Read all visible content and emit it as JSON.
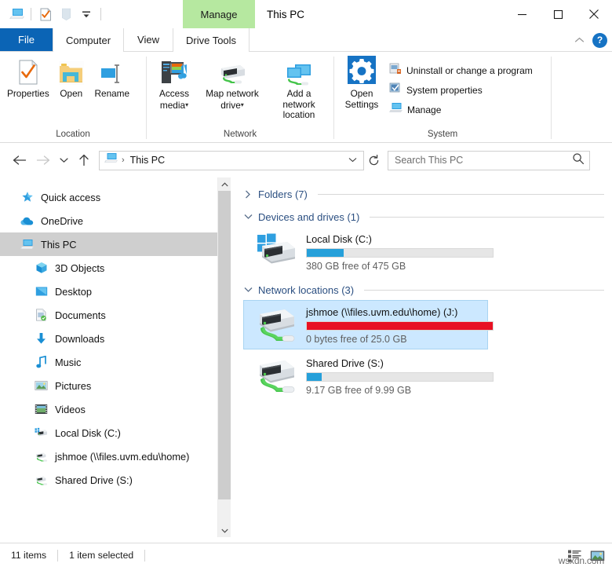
{
  "window": {
    "title": "This PC",
    "quick_access_toolbar": [
      {
        "name": "this-pc-icon",
        "label": "This PC"
      },
      {
        "name": "properties-icon",
        "label": "Properties"
      },
      {
        "name": "new-folder-icon",
        "label": "New folder"
      },
      {
        "name": "customize-qat-icon",
        "label": "Customize Quick Access Toolbar"
      }
    ],
    "controls": {
      "minimize": "Minimize",
      "maximize": "Maximize",
      "close": "Close"
    }
  },
  "contextual_tab": {
    "header": "Manage",
    "child_tab": "Drive Tools",
    "color": "#b6e8a0"
  },
  "tabs": [
    {
      "label": "File",
      "name": "tab-file",
      "state": "file"
    },
    {
      "label": "Computer",
      "name": "tab-computer",
      "state": "active"
    },
    {
      "label": "View",
      "name": "tab-view",
      "state": "normal"
    },
    {
      "label": "Drive Tools",
      "name": "tab-drive-tools",
      "state": "contextual"
    }
  ],
  "tabstrip_right": {
    "collapse_ribbon": "Minimize the Ribbon",
    "help": "?"
  },
  "ribbon": {
    "groups": [
      {
        "title": "Location",
        "name": "ribbon-group-location",
        "buttons": [
          {
            "label": "Properties",
            "name": "properties-button",
            "icon": "properties-icon",
            "has_caret": false
          },
          {
            "label": "Open",
            "name": "open-button",
            "icon": "open-folder-icon",
            "has_caret": false
          },
          {
            "label": "Rename",
            "name": "rename-button",
            "icon": "rename-icon",
            "has_caret": false
          }
        ]
      },
      {
        "title": "Network",
        "name": "ribbon-group-network",
        "buttons": [
          {
            "label": "Access\nmedia",
            "name": "access-media-button",
            "icon": "access-media-icon",
            "has_caret": true
          },
          {
            "label": "Map network\ndrive",
            "name": "map-network-drive-button",
            "icon": "network-drive-icon",
            "has_caret": true
          },
          {
            "label": "Add a network\nlocation",
            "name": "add-network-location-button",
            "icon": "add-network-location-icon",
            "has_caret": false
          }
        ]
      },
      {
        "title": "System",
        "name": "ribbon-group-system",
        "buttons": [
          {
            "label": "Open\nSettings",
            "name": "open-settings-button",
            "icon": "gear-icon",
            "has_caret": false
          }
        ],
        "list_items": [
          {
            "label": "Uninstall or change a program",
            "name": "uninstall-program-item",
            "icon": "uninstall-icon"
          },
          {
            "label": "System properties",
            "name": "system-properties-item",
            "icon": "system-properties-icon"
          },
          {
            "label": "Manage",
            "name": "manage-item",
            "icon": "manage-icon"
          }
        ]
      }
    ]
  },
  "addressbar": {
    "back": "Back",
    "forward": "Forward",
    "recent": "Recent locations",
    "up": "Up",
    "breadcrumb_icon": "this-pc-icon",
    "breadcrumb_separator": "›",
    "breadcrumb": "This PC",
    "dropdown": "Previous locations",
    "refresh": "Refresh",
    "search_placeholder": "Search This PC",
    "search_value": ""
  },
  "navpane": {
    "items": [
      {
        "label": "Quick access",
        "name": "sidebar-item-quick-access",
        "icon": "star-icon",
        "indent": false,
        "selected": false
      },
      {
        "label": "OneDrive",
        "name": "sidebar-item-onedrive",
        "icon": "cloud-icon",
        "indent": false,
        "selected": false
      },
      {
        "label": "This PC",
        "name": "sidebar-item-this-pc",
        "icon": "this-pc-icon",
        "indent": false,
        "selected": true
      },
      {
        "label": "3D Objects",
        "name": "sidebar-item-3d-objects",
        "icon": "cube-icon",
        "indent": true,
        "selected": false
      },
      {
        "label": "Desktop",
        "name": "sidebar-item-desktop",
        "icon": "desktop-icon",
        "indent": true,
        "selected": false
      },
      {
        "label": "Documents",
        "name": "sidebar-item-documents",
        "icon": "documents-icon",
        "indent": true,
        "selected": false
      },
      {
        "label": "Downloads",
        "name": "sidebar-item-downloads",
        "icon": "download-arrow-icon",
        "indent": true,
        "selected": false
      },
      {
        "label": "Music",
        "name": "sidebar-item-music",
        "icon": "music-note-icon",
        "indent": true,
        "selected": false
      },
      {
        "label": "Pictures",
        "name": "sidebar-item-pictures",
        "icon": "pictures-icon",
        "indent": true,
        "selected": false
      },
      {
        "label": "Videos",
        "name": "sidebar-item-videos",
        "icon": "videos-icon",
        "indent": true,
        "selected": false
      },
      {
        "label": "Local Disk (C:)",
        "name": "sidebar-item-local-disk-c",
        "icon": "hard-drive-icon",
        "indent": true,
        "selected": false
      },
      {
        "label": "jshmoe (\\\\files.uvm.edu\\home)",
        "name": "sidebar-item-jshmoe",
        "icon": "network-drive-icon",
        "indent": true,
        "selected": false
      },
      {
        "label": "Shared Drive (S:)",
        "name": "sidebar-item-shared-drive-s",
        "icon": "network-drive-icon",
        "indent": true,
        "selected": false
      }
    ],
    "scrollbar": {
      "up": "Scroll up",
      "down": "Scroll down",
      "thumb": "Scroll thumb"
    }
  },
  "content": {
    "groups": [
      {
        "title": "Folders (7)",
        "name": "group-folders",
        "expanded": false,
        "chevron": "›",
        "items": []
      },
      {
        "title": "Devices and drives (1)",
        "name": "group-devices-and-drives",
        "expanded": true,
        "chevron": "⌄",
        "items": [
          {
            "name": "drive-tile-local-disk-c",
            "label": "Local Disk (C:)",
            "sub": "380 GB free of 475 GB",
            "icon": "windows-drive-icon",
            "fill_percent": 20,
            "fill_color": "#26a0da",
            "selected": false
          }
        ]
      },
      {
        "title": "Network locations (3)",
        "name": "group-network-locations",
        "expanded": true,
        "chevron": "⌄",
        "items": [
          {
            "name": "drive-tile-jshmoe",
            "label": "jshmoe (\\\\files.uvm.edu\\home) (J:)",
            "sub": "0 bytes free of 25.0 GB",
            "icon": "network-drive-icon",
            "fill_percent": 100,
            "fill_color": "#e81123",
            "selected": true
          },
          {
            "name": "drive-tile-shared-drive-s",
            "label": "Shared Drive (S:)",
            "sub": "9.17 GB free of 9.99 GB",
            "icon": "network-drive-icon",
            "fill_percent": 8,
            "fill_color": "#26a0da",
            "selected": false
          }
        ]
      }
    ]
  },
  "statusbar": {
    "item_count": "11 items",
    "selection": "1 item selected",
    "views": [
      {
        "name": "details-view-button",
        "label": "Details view"
      },
      {
        "name": "large-icons-view-button",
        "label": "Large icons view"
      }
    ],
    "watermark": "wsxdn.com"
  }
}
